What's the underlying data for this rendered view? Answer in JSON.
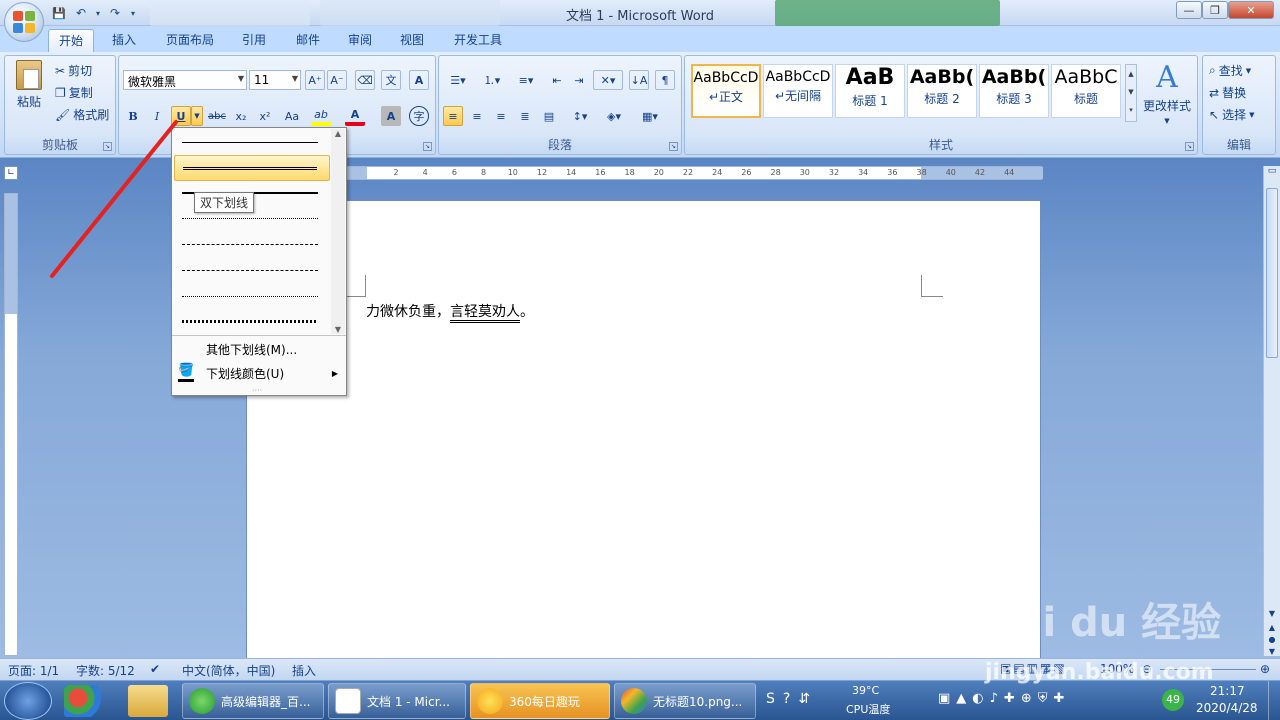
{
  "window": {
    "title": "文档 1 - Microsoft Word",
    "controls": {
      "minimize": "—",
      "restore": "❐",
      "close": "✕"
    }
  },
  "qat": {
    "save": "💾",
    "undo": "↶",
    "redo": "↷",
    "customize": "▾"
  },
  "tabs": [
    "开始",
    "插入",
    "页面布局",
    "引用",
    "邮件",
    "审阅",
    "视图",
    "开发工具"
  ],
  "clipboard": {
    "paste": "粘贴",
    "cut": "剪切",
    "copy": "复制",
    "format_painter": "格式刷",
    "label": "剪贴板"
  },
  "font": {
    "name": "微软雅黑",
    "size": "11",
    "grow": "A⁺",
    "shrink": "A⁻",
    "bold": "B",
    "italic": "I",
    "underline": "U",
    "strike": "abc",
    "subscript": "x₂",
    "superscript": "x²",
    "case": "Aa",
    "highlight": "ab",
    "color": "A"
  },
  "paragraph": {
    "label": "段落"
  },
  "styles": {
    "items": [
      {
        "sample": "AaBbCcD",
        "name": "↵正文"
      },
      {
        "sample": "AaBbCcD",
        "name": "↵无间隔"
      },
      {
        "sample": "AaB",
        "name": "标题 1"
      },
      {
        "sample": "AaBb(",
        "name": "标题 2"
      },
      {
        "sample": "AaBb(",
        "name": "标题 3"
      },
      {
        "sample": "AaBbC",
        "name": "标题"
      }
    ],
    "change": "更改样式",
    "label": "样式"
  },
  "editing": {
    "find": "查找",
    "replace": "替换",
    "select": "选择",
    "label": "编辑"
  },
  "ruler": {
    "ticks": [
      "2",
      "4",
      "6",
      "8",
      "10",
      "12",
      "14",
      "16",
      "18",
      "20",
      "22",
      "24",
      "26",
      "28",
      "30",
      "32",
      "34",
      "36",
      "38",
      "40",
      "42",
      "44"
    ]
  },
  "document": {
    "text_plain": "力微休负重，",
    "text_underlined": "言轻莫劝人",
    "text_end": "。"
  },
  "underline_menu": {
    "tooltip": "双下划线",
    "more": "其他下划线(M)...",
    "color": "下划线颜色(U)"
  },
  "statusbar": {
    "page": "页面: 1/1",
    "words": "字数: 5/12",
    "language": "中文(简体，中国)",
    "mode": "插入",
    "zoom": "100%"
  },
  "taskbar": {
    "tasks": [
      "高级编辑器_百...",
      "文档 1 - Micr...",
      "360每日趣玩",
      "无标题10.png..."
    ],
    "temp": "39°C",
    "temp_label": "CPU温度",
    "badge": "49",
    "time": "21:17",
    "date": "2020/4/28"
  },
  "watermark": {
    "logo": "Bai du 经验",
    "url": "jingyan.baidu.com"
  }
}
